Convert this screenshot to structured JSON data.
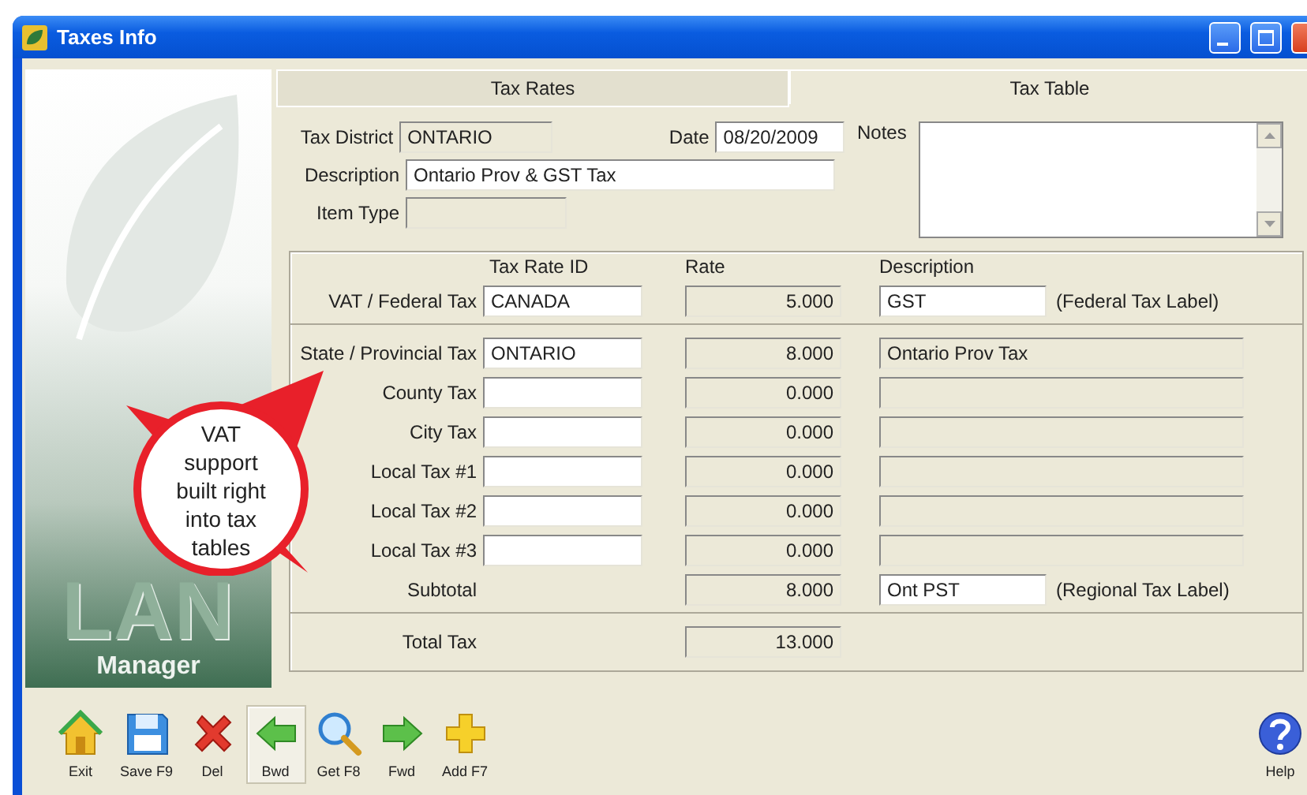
{
  "window": {
    "title": "Taxes Info"
  },
  "sidebar": {
    "logo_word": "LAN",
    "logo_caption": "Manager"
  },
  "tabs": [
    {
      "label": "Tax Rates",
      "selected": false
    },
    {
      "label": "Tax Table",
      "selected": true
    }
  ],
  "form": {
    "tax_district": {
      "label": "Tax District",
      "value": "ONTARIO",
      "disabled": true
    },
    "date": {
      "label": "Date",
      "value": "08/20/2009",
      "disabled": false
    },
    "description": {
      "label": "Description",
      "value": "Ontario Prov & GST Tax",
      "disabled": false
    },
    "item_type": {
      "label": "Item Type",
      "disabled": true
    },
    "notes": {
      "label": "Notes"
    }
  },
  "rates": {
    "headers": {
      "tax_rate_id": "Tax Rate ID",
      "rate": "Rate",
      "description": "Description"
    },
    "rows": [
      {
        "kind": "federal",
        "label": "VAT / Federal Tax",
        "tax_rate_id": "CANADA",
        "rate": "5.000",
        "description": {
          "value": "GST",
          "disabled": false
        },
        "note": "(Federal Tax Label)"
      },
      {
        "kind": "component",
        "label": "State / Provincial Tax",
        "tax_rate_id": "ONTARIO",
        "rate": "8.000",
        "description": {
          "value": "Ontario Prov Tax",
          "disabled": true
        }
      },
      {
        "kind": "component",
        "label": "County Tax",
        "rate": "0.000",
        "description": {
          "disabled": true
        }
      },
      {
        "kind": "component",
        "label": "City Tax",
        "rate": "0.000",
        "description": {
          "disabled": true
        }
      },
      {
        "kind": "component",
        "label": "Local Tax #1",
        "rate": "0.000",
        "description": {
          "disabled": true
        }
      },
      {
        "kind": "component",
        "label": "Local Tax #2",
        "rate": "0.000",
        "description": {
          "disabled": true
        }
      },
      {
        "kind": "component",
        "label": "Local Tax #3",
        "rate": "0.000",
        "description": {
          "disabled": true
        }
      },
      {
        "kind": "subtotal",
        "label": "Subtotal",
        "rate": "8.000",
        "description": {
          "value": "Ont PST",
          "disabled": false
        },
        "note": "(Regional Tax Label)"
      },
      {
        "kind": "total",
        "label": "Total Tax",
        "rate": "13.000"
      }
    ]
  },
  "callout": {
    "text": "VAT support built right into tax tables"
  },
  "toolbar": [
    {
      "label": "Exit",
      "selected": false
    },
    {
      "label": "Save F9",
      "selected": false
    },
    {
      "label": "Del",
      "selected": false
    },
    {
      "label": "Bwd",
      "selected": true
    },
    {
      "label": "Get F8",
      "selected": false
    },
    {
      "label": "Fwd",
      "selected": false
    },
    {
      "label": "Add F7",
      "selected": false
    }
  ],
  "help": {
    "label": "Help"
  }
}
